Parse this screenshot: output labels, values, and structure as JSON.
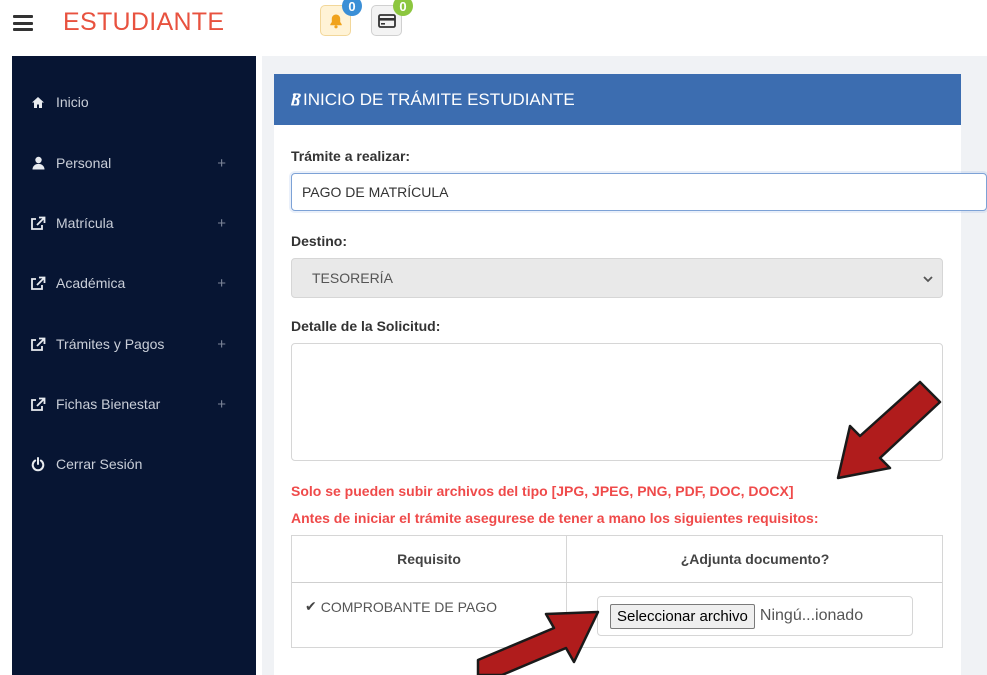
{
  "header": {
    "brand": "ESTUDIANTE",
    "notifications_count": "0",
    "cards_count": "0"
  },
  "sidebar": {
    "items": [
      {
        "label": "Inicio",
        "icon": "home-icon",
        "expandable": false
      },
      {
        "label": "Personal",
        "icon": "user-icon",
        "expandable": true
      },
      {
        "label": "Matrícula",
        "icon": "external-link-icon",
        "expandable": true
      },
      {
        "label": "Académica",
        "icon": "external-link-icon",
        "expandable": true
      },
      {
        "label": "Trámites y Pagos",
        "icon": "external-link-icon",
        "expandable": true
      },
      {
        "label": "Fichas Bienestar",
        "icon": "external-link-icon",
        "expandable": true
      },
      {
        "label": "Cerrar Sesión",
        "icon": "power-icon",
        "expandable": false
      }
    ],
    "plus": "+"
  },
  "panel": {
    "title": "INICIO DE TRÁMITE ESTUDIANTE"
  },
  "form": {
    "tramite_label": "Trámite a realizar:",
    "tramite_value": "PAGO DE MATRÍCULA",
    "destino_label": "Destino:",
    "destino_value": "TESORERÍA",
    "detalle_label": "Detalle de la Solicitud:",
    "detalle_value": "",
    "warning_types": "Solo se pueden subir archivos del tipo [JPG, JPEG, PNG, PDF, DOC, DOCX]",
    "warning_requirements": "Antes de iniciar el trámite asegurese de tener a mano los siguientes requisitos:"
  },
  "requirements": {
    "col_requisito": "Requisito",
    "col_adjunta": "¿Adjunta documento?",
    "rows": [
      {
        "name": "COMPROBANTE DE PAGO",
        "file_button": "Seleccionar archivo",
        "file_status": "Ningú...ionado"
      }
    ]
  },
  "colors": {
    "brand": "#e8523f",
    "sidebar": "#071533",
    "panel_header": "#3c6db0",
    "warning": "#ef4a4a",
    "arrow": "#b01c1c"
  }
}
